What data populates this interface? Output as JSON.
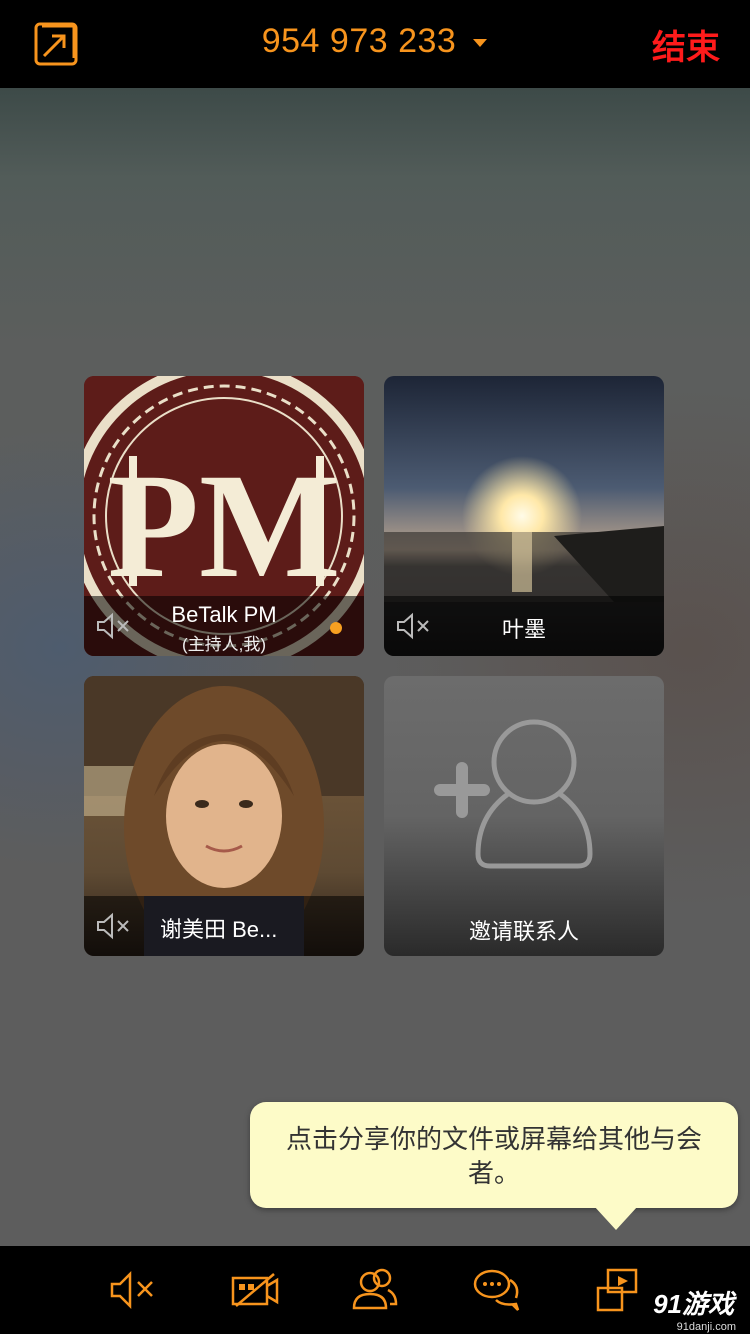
{
  "header": {
    "meeting_id": "954 973 233",
    "end_label": "结束",
    "accent_color": "#f7941d",
    "end_color": "#ff1b1b"
  },
  "participants": [
    {
      "name": "BeTalk PM",
      "role": "(主持人,我)",
      "avatar_text": "PM",
      "muted_icon": "mic-muted-icon",
      "active": true
    },
    {
      "name": "叶墨",
      "muted_icon": "mic-muted-icon"
    },
    {
      "name": "谢美田 Be...",
      "muted_icon": "mic-muted-icon"
    }
  ],
  "invite": {
    "label": "邀请联系人",
    "icon": "add-contact-icon"
  },
  "tooltip": {
    "text": "点击分享你的文件或屏幕给其他与会者。"
  },
  "toolbar": {
    "items": [
      "mute-icon",
      "video-off-icon",
      "participants-icon",
      "chat-icon",
      "share-icon"
    ]
  },
  "watermark": {
    "brand": "91游戏",
    "site": "91danji.com"
  }
}
